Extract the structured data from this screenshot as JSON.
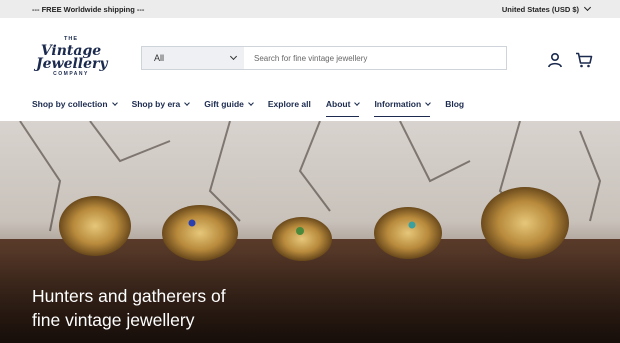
{
  "announcement": {
    "text": "--- FREE Worldwide shipping ---"
  },
  "currency": {
    "label": "United States (USD $)"
  },
  "logo": {
    "the": "THE",
    "line1": "Vintage",
    "line2": "Jewellery",
    "line3": "COMPANY"
  },
  "search": {
    "category": "All",
    "placeholder": "Search for fine vintage jewellery"
  },
  "header_icons": [
    "account-icon",
    "cart-icon"
  ],
  "nav": [
    {
      "label": "Shop by collection",
      "dropdown": true
    },
    {
      "label": "Shop by era",
      "dropdown": true
    },
    {
      "label": "Gift guide",
      "dropdown": true
    },
    {
      "label": "Explore all",
      "dropdown": false
    },
    {
      "label": "About",
      "dropdown": true
    },
    {
      "label": "Information",
      "dropdown": true
    },
    {
      "label": "Blog",
      "dropdown": false
    }
  ],
  "hero": {
    "line1": "Hunters and gatherers of",
    "line2": "fine vintage jewellery"
  },
  "colors": {
    "brand_navy": "#1b2a4e",
    "announcement_bg": "#ececec"
  }
}
